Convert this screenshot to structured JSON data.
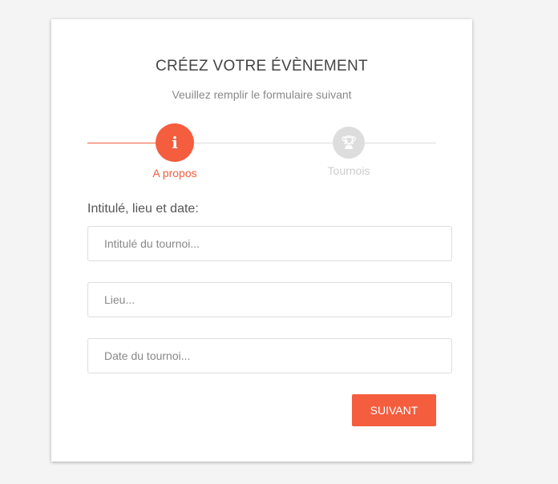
{
  "header": {
    "title": "CRÉEZ VOTRE ÉVÈNEMENT",
    "subtitle": "Veuillez remplir le formulaire suivant"
  },
  "steps": [
    {
      "label": "A propos",
      "icon": "info-icon",
      "active": true
    },
    {
      "label": "Tournois",
      "icon": "trophy-icon",
      "active": false
    }
  ],
  "form": {
    "section_label": "Intitulé, lieu et date:",
    "fields": [
      {
        "placeholder": "Intitulé du tournoi...",
        "value": ""
      },
      {
        "placeholder": "Lieu...",
        "value": ""
      },
      {
        "placeholder": "Date du tournoi...",
        "value": ""
      }
    ],
    "next_label": "SUIVANT"
  },
  "colors": {
    "accent": "#f45d3e",
    "inactive": "#dddddd"
  }
}
